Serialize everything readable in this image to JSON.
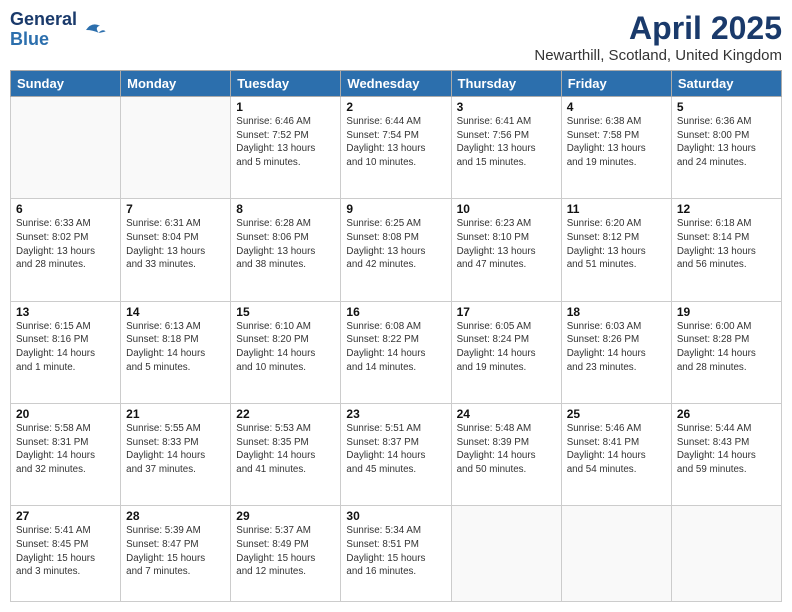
{
  "logo": {
    "line1": "General",
    "line2": "Blue"
  },
  "title": "April 2025",
  "subtitle": "Newarthill, Scotland, United Kingdom",
  "days_of_week": [
    "Sunday",
    "Monday",
    "Tuesday",
    "Wednesday",
    "Thursday",
    "Friday",
    "Saturday"
  ],
  "weeks": [
    [
      {
        "num": "",
        "info": ""
      },
      {
        "num": "",
        "info": ""
      },
      {
        "num": "1",
        "info": "Sunrise: 6:46 AM\nSunset: 7:52 PM\nDaylight: 13 hours\nand 5 minutes."
      },
      {
        "num": "2",
        "info": "Sunrise: 6:44 AM\nSunset: 7:54 PM\nDaylight: 13 hours\nand 10 minutes."
      },
      {
        "num": "3",
        "info": "Sunrise: 6:41 AM\nSunset: 7:56 PM\nDaylight: 13 hours\nand 15 minutes."
      },
      {
        "num": "4",
        "info": "Sunrise: 6:38 AM\nSunset: 7:58 PM\nDaylight: 13 hours\nand 19 minutes."
      },
      {
        "num": "5",
        "info": "Sunrise: 6:36 AM\nSunset: 8:00 PM\nDaylight: 13 hours\nand 24 minutes."
      }
    ],
    [
      {
        "num": "6",
        "info": "Sunrise: 6:33 AM\nSunset: 8:02 PM\nDaylight: 13 hours\nand 28 minutes."
      },
      {
        "num": "7",
        "info": "Sunrise: 6:31 AM\nSunset: 8:04 PM\nDaylight: 13 hours\nand 33 minutes."
      },
      {
        "num": "8",
        "info": "Sunrise: 6:28 AM\nSunset: 8:06 PM\nDaylight: 13 hours\nand 38 minutes."
      },
      {
        "num": "9",
        "info": "Sunrise: 6:25 AM\nSunset: 8:08 PM\nDaylight: 13 hours\nand 42 minutes."
      },
      {
        "num": "10",
        "info": "Sunrise: 6:23 AM\nSunset: 8:10 PM\nDaylight: 13 hours\nand 47 minutes."
      },
      {
        "num": "11",
        "info": "Sunrise: 6:20 AM\nSunset: 8:12 PM\nDaylight: 13 hours\nand 51 minutes."
      },
      {
        "num": "12",
        "info": "Sunrise: 6:18 AM\nSunset: 8:14 PM\nDaylight: 13 hours\nand 56 minutes."
      }
    ],
    [
      {
        "num": "13",
        "info": "Sunrise: 6:15 AM\nSunset: 8:16 PM\nDaylight: 14 hours\nand 1 minute."
      },
      {
        "num": "14",
        "info": "Sunrise: 6:13 AM\nSunset: 8:18 PM\nDaylight: 14 hours\nand 5 minutes."
      },
      {
        "num": "15",
        "info": "Sunrise: 6:10 AM\nSunset: 8:20 PM\nDaylight: 14 hours\nand 10 minutes."
      },
      {
        "num": "16",
        "info": "Sunrise: 6:08 AM\nSunset: 8:22 PM\nDaylight: 14 hours\nand 14 minutes."
      },
      {
        "num": "17",
        "info": "Sunrise: 6:05 AM\nSunset: 8:24 PM\nDaylight: 14 hours\nand 19 minutes."
      },
      {
        "num": "18",
        "info": "Sunrise: 6:03 AM\nSunset: 8:26 PM\nDaylight: 14 hours\nand 23 minutes."
      },
      {
        "num": "19",
        "info": "Sunrise: 6:00 AM\nSunset: 8:28 PM\nDaylight: 14 hours\nand 28 minutes."
      }
    ],
    [
      {
        "num": "20",
        "info": "Sunrise: 5:58 AM\nSunset: 8:31 PM\nDaylight: 14 hours\nand 32 minutes."
      },
      {
        "num": "21",
        "info": "Sunrise: 5:55 AM\nSunset: 8:33 PM\nDaylight: 14 hours\nand 37 minutes."
      },
      {
        "num": "22",
        "info": "Sunrise: 5:53 AM\nSunset: 8:35 PM\nDaylight: 14 hours\nand 41 minutes."
      },
      {
        "num": "23",
        "info": "Sunrise: 5:51 AM\nSunset: 8:37 PM\nDaylight: 14 hours\nand 45 minutes."
      },
      {
        "num": "24",
        "info": "Sunrise: 5:48 AM\nSunset: 8:39 PM\nDaylight: 14 hours\nand 50 minutes."
      },
      {
        "num": "25",
        "info": "Sunrise: 5:46 AM\nSunset: 8:41 PM\nDaylight: 14 hours\nand 54 minutes."
      },
      {
        "num": "26",
        "info": "Sunrise: 5:44 AM\nSunset: 8:43 PM\nDaylight: 14 hours\nand 59 minutes."
      }
    ],
    [
      {
        "num": "27",
        "info": "Sunrise: 5:41 AM\nSunset: 8:45 PM\nDaylight: 15 hours\nand 3 minutes."
      },
      {
        "num": "28",
        "info": "Sunrise: 5:39 AM\nSunset: 8:47 PM\nDaylight: 15 hours\nand 7 minutes."
      },
      {
        "num": "29",
        "info": "Sunrise: 5:37 AM\nSunset: 8:49 PM\nDaylight: 15 hours\nand 12 minutes."
      },
      {
        "num": "30",
        "info": "Sunrise: 5:34 AM\nSunset: 8:51 PM\nDaylight: 15 hours\nand 16 minutes."
      },
      {
        "num": "",
        "info": ""
      },
      {
        "num": "",
        "info": ""
      },
      {
        "num": "",
        "info": ""
      }
    ]
  ]
}
